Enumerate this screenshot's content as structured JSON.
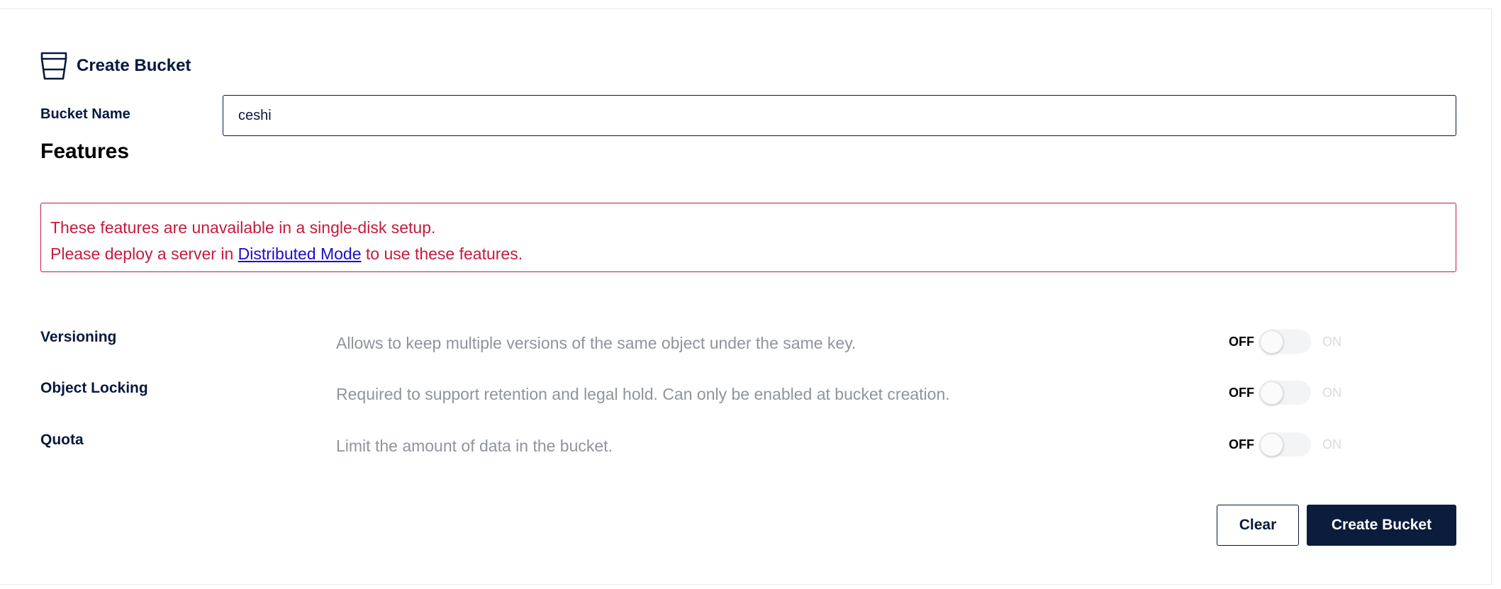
{
  "header": {
    "icon": "bucket-icon",
    "title": "Create Bucket"
  },
  "form": {
    "bucket_name_label": "Bucket Name",
    "bucket_name_value": "ceshi"
  },
  "features": {
    "heading": "Features",
    "error": {
      "line1": "These features are unavailable in a single-disk setup.",
      "line2_prefix": "Please deploy a server in",
      "link_text": "Distributed Mode",
      "line2_suffix": "to use these features.",
      "color": "#c51b3f",
      "link_color": "#1a0dcc"
    },
    "items": [
      {
        "name": "Versioning",
        "description": "Allows to keep multiple versions of the same object under the same key.",
        "off_label": "OFF",
        "on_label": "ON",
        "enabled": false
      },
      {
        "name": "Object Locking",
        "description": "Required to support retention and legal hold. Can only be enabled at bucket creation.",
        "off_label": "OFF",
        "on_label": "ON",
        "enabled": false
      },
      {
        "name": "Quota",
        "description": "Limit the amount of data in the bucket.",
        "off_label": "OFF",
        "on_label": "ON",
        "enabled": false
      }
    ]
  },
  "actions": {
    "clear_label": "Clear",
    "create_label": "Create Bucket"
  },
  "colors": {
    "primary": "#07193e",
    "primary_button_bg": "#0b1c3c",
    "muted_text": "#8f949c"
  }
}
